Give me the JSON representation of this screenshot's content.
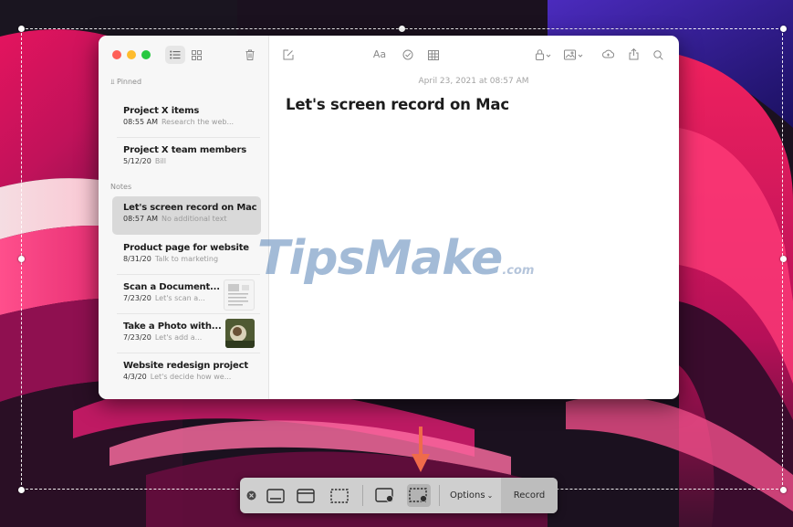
{
  "notes_app": {
    "sidebar": {
      "pinned_label": "Pinned",
      "notes_label": "Notes",
      "pinned_items": [
        {
          "title": "Project X items",
          "date": "08:55 AM",
          "preview": "Research the web..."
        },
        {
          "title": "Project X team members",
          "date": "5/12/20",
          "preview": "Bill"
        }
      ],
      "notes_items": [
        {
          "title": "Let's screen record on Mac",
          "date": "08:57 AM",
          "preview": "No additional text",
          "selected": true
        },
        {
          "title": "Product page for website",
          "date": "8/31/20",
          "preview": "Talk to marketing"
        },
        {
          "title": "Scan a Document...",
          "date": "7/23/20",
          "preview": "Let's scan a..."
        },
        {
          "title": "Take a Photo with...",
          "date": "7/23/20",
          "preview": "Let's add a..."
        },
        {
          "title": "Website redesign project",
          "date": "4/3/20",
          "preview": "Let's decide how we..."
        }
      ]
    },
    "toolbar": {
      "format_label": "Aa"
    },
    "editor": {
      "date": "April 23, 2021 at 08:57 AM",
      "title": "Let's screen record on Mac"
    }
  },
  "watermark": {
    "brand": "TipsMake",
    "suffix": ".com",
    "color": "#5884b7"
  },
  "screenshot_toolbar": {
    "options_label": "Options",
    "record_label": "Record",
    "active_tool": "record-selected-portion"
  },
  "colors": {
    "traffic_red": "#fe5f57",
    "traffic_yellow": "#febc2e",
    "traffic_green": "#28c840",
    "arrow": "#ef6b4a"
  }
}
